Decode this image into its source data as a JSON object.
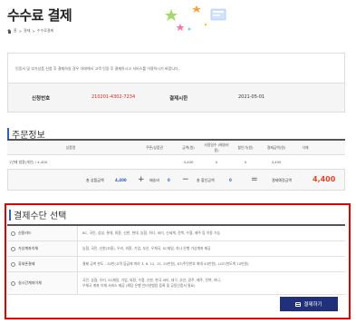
{
  "header": {
    "title": "수수료 결제",
    "breadcrumb": [
      "홈",
      "결제",
      "수수료결제"
    ]
  },
  "notice": {
    "text": "인증서 및 부가상품 신청 후 결제하실 경우 아래에서 고객 인증 후 결제하시고 서비스를 이용하시기 바랍니다."
  },
  "order_info": {
    "number_label": "신청번호",
    "number_value": "210201-4302-7234",
    "date_label": "결제시한",
    "date_value": "2021-05-01"
  },
  "order_section": {
    "title": "주문정보",
    "columns": [
      "상품명",
      "쿠폰/상품권",
      "금액(원)",
      "사용일수 (배송비용)",
      "할인가(원)",
      "결제금액(원)",
      "삭제"
    ],
    "rows": [
      {
        "name": "1년제 범용(개인) / 4,400",
        "coupon": "",
        "amount": "4,400",
        "days": "0",
        "discount": "0",
        "payment": "4,400",
        "delete": ""
      }
    ],
    "totals": {
      "product_label": "총 상품금액",
      "product_value": "4,400",
      "shipping_label": "배송비",
      "shipping_value": "0",
      "discount_label": "총 할인금액",
      "discount_value": "0",
      "final_label": "결제예정금액",
      "final_value": "4,400",
      "plus": "+",
      "minus": "−",
      "equals": "="
    }
  },
  "payment_section": {
    "title": "결제수단 선택",
    "methods": [
      {
        "label": "신용카드",
        "desc": "BC, 국민, 삼성, 롯데, 외환, 신한, 현대, 농협, 하나, 씨티, 신세계, 전북, 수협, 제주 등 이용 가능"
      },
      {
        "label": "가상계좌이체",
        "desc": "농협, 국민, 신한(조흥), 우리, 외환, 기업, 부산, 우체국, SC제일, 하나 은행 가상계좌 제공"
      },
      {
        "label": "휴대폰결제",
        "desc": "결제 금액 한도 : 30만(고객 등급에 따라 3, 6, 12, 15, 20만원), KT(주민번호 최대 45만원), LGT(한도액 10만원)"
      },
      {
        "label": "실시간계좌이체",
        "desc1": "국민, 농협, 우리, SC제일, 기업, 외환, 수협, 신한, 한국 씨티, 대구, 부산, 광주, 제주, 전북, 하나,",
        "desc2": "우체국 계좌 이체 서비스 제공 (해당 은행 인터넷뱅킹 등록 및 공동인증서 필요)"
      }
    ],
    "pay_button": "결제하기"
  },
  "colors": {
    "accent_blue": "#2d5fbf",
    "highlight_red": "#e00000",
    "button_navy": "#20307a",
    "value_red": "#d0281f"
  }
}
